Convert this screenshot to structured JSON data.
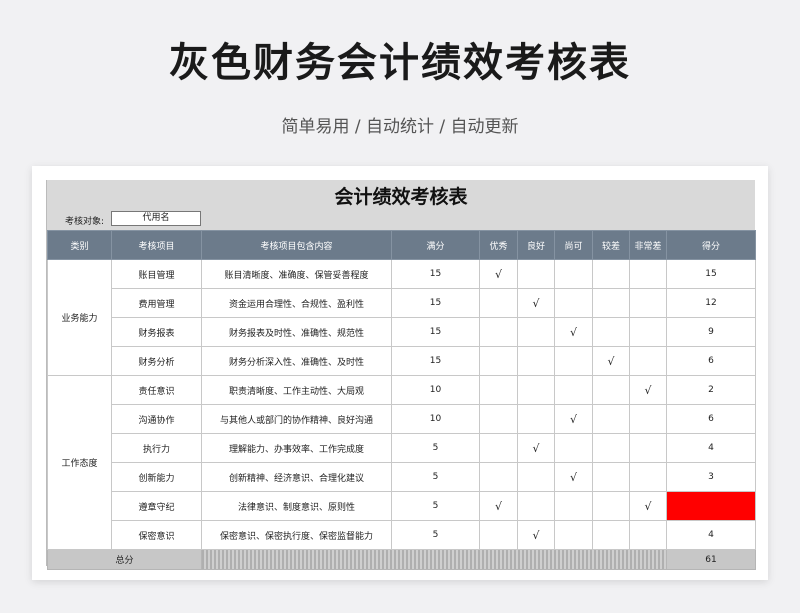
{
  "header": {
    "title": "灰色财务会计绩效考核表",
    "subtitle": "简单易用 / 自动统计 / 自动更新"
  },
  "sheet": {
    "title": "会计绩效考核表",
    "target_label": "考核对象:",
    "target_value": "代用名",
    "columns": [
      "类别",
      "考核项目",
      "考核项目包含内容",
      "满分",
      "优秀",
      "良好",
      "尚可",
      "较差",
      "非常差",
      "得分"
    ],
    "categories": [
      "业务能力",
      "工作态度"
    ],
    "rows": [
      {
        "item": "账目管理",
        "content": "账目清晰度、准确度、保管妥善程度",
        "full": "15",
        "rating": 0,
        "score": "15"
      },
      {
        "item": "费用管理",
        "content": "资金运用合理性、合规性、盈利性",
        "full": "15",
        "rating": 1,
        "score": "12"
      },
      {
        "item": "财务报表",
        "content": "财务报表及时性、准确性、规范性",
        "full": "15",
        "rating": 2,
        "score": "9"
      },
      {
        "item": "财务分析",
        "content": "财务分析深入性、准确性、及时性",
        "full": "15",
        "rating": 3,
        "score": "6"
      },
      {
        "item": "责任意识",
        "content": "职责清晰度、工作主动性、大局观",
        "full": "10",
        "rating": 4,
        "score": "2"
      },
      {
        "item": "沟通协作",
        "content": "与其他人或部门的协作精神、良好沟通",
        "full": "10",
        "rating": 2,
        "score": "6"
      },
      {
        "item": "执行力",
        "content": "理解能力、办事效率、工作完成度",
        "full": "5",
        "rating": 1,
        "score": "4"
      },
      {
        "item": "创新能力",
        "content": "创新精神、经济意识、合理化建议",
        "full": "5",
        "rating": 2,
        "score": "3"
      },
      {
        "item": "遵章守纪",
        "content": "法律意识、制度意识、原则性",
        "full": "5",
        "rating": [
          0,
          4
        ],
        "score": ""
      },
      {
        "item": "保密意识",
        "content": "保密意识、保密执行度、保密监督能力",
        "full": "5",
        "rating": 1,
        "score": "4"
      }
    ],
    "check_mark": "√",
    "total_label": "总分",
    "total_value": "61",
    "colors": {
      "header_bg": "#6c7b8b",
      "alert": "#ff0000",
      "sheet_head": "#d9d9d9"
    }
  }
}
